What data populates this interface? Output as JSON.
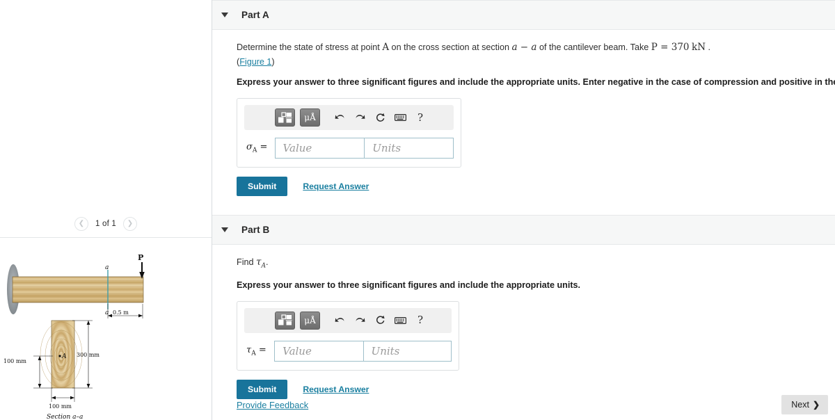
{
  "figure": {
    "pager": {
      "label": "1 of 1",
      "prev_icon": "chevron-left-icon",
      "next_icon": "chevron-right-icon"
    },
    "labels": {
      "load": "P",
      "section_top": "a",
      "section_bottom": "a",
      "length": "0.5 m",
      "depth": "300 mm",
      "point_offset": "100 mm",
      "width": "100 mm",
      "caption": "Section a–a",
      "point": "A"
    },
    "colors": {
      "wood_light": "#e4cb96",
      "wood_mid": "#cbab6e",
      "wood_dark": "#ab8a4d",
      "section_line": "#3f9ca8",
      "wall": "#9aa0a4"
    }
  },
  "parts": [
    {
      "id": "part-a",
      "caret_icon": "caret-down-icon",
      "title": "Part A",
      "prompt_pre": "Determine the state of stress at point ",
      "prompt_var1": "A",
      "prompt_mid": " on the cross section at section ",
      "prompt_var2": "a − a",
      "prompt_post": " of the cantilever beam. Take ",
      "prompt_var3": "P",
      "prompt_eq": " = 370",
      "prompt_unit": "kN",
      "prompt_end": ".",
      "figure_link": "Figure 1",
      "figure_link_open": "(",
      "figure_link_close": ")",
      "instruction": "Express your answer to three significant figures and include the appropriate units. Enter negative in the case of compression and positive in the case of tension.",
      "field_label_sym": "σ",
      "field_label_sub": "A",
      "field_label_eq": " =",
      "value_placeholder": "Value",
      "units_placeholder": "Units",
      "submit_label": "Submit",
      "request_label": "Request Answer"
    },
    {
      "id": "part-b",
      "caret_icon": "caret-down-icon",
      "title": "Part B",
      "prompt_pre": "Find ",
      "prompt_var1": "τ",
      "prompt_sub1": "A",
      "prompt_post": ".",
      "instruction": "Express your answer to three significant figures and include the appropriate units.",
      "field_label_sym": "τ",
      "field_label_sub": "A",
      "field_label_eq": " =",
      "value_placeholder": "Value",
      "units_placeholder": "Units",
      "submit_label": "Submit",
      "request_label": "Request Answer"
    }
  ],
  "mathbar": {
    "template_icon": "math-template-icon",
    "units_icon": "units-micro-angstrom-icon",
    "units_label": "μÅ",
    "undo_icon": "undo-arrow-icon",
    "redo_icon": "redo-arrow-icon",
    "reset_icon": "reset-circular-arrow-icon",
    "keyboard_icon": "keyboard-icon",
    "help_icon": "help-question-icon",
    "help_label": "?"
  },
  "footer": {
    "feedback_label": "Provide Feedback",
    "next_label": "Next",
    "next_chevron": "❯"
  },
  "colors": {
    "accent_link": "#1a7fa0",
    "submit_bg": "#18749b",
    "header_bg": "#f6f7f7",
    "input_border": "#9fbfca",
    "next_bg": "#e2e2e2"
  }
}
